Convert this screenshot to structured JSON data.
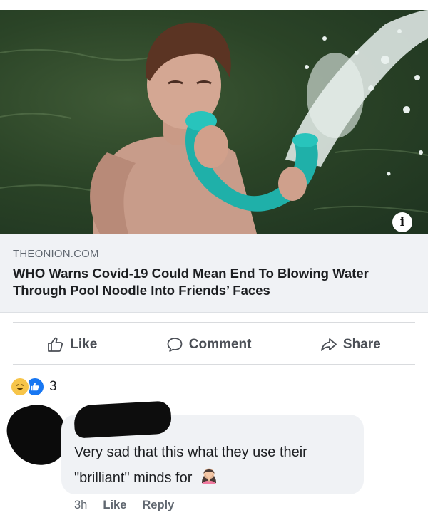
{
  "post": {
    "link_preview": {
      "domain": "THEONION.COM",
      "headline": "WHO Warns Covid-19 Could Mean End To Blowing Water Through Pool Noodle Into Friends’ Faces"
    },
    "actions": {
      "like_label": "Like",
      "comment_label": "Comment",
      "share_label": "Share"
    },
    "reactions": {
      "types": [
        "haha",
        "like"
      ],
      "count": "3"
    }
  },
  "comment": {
    "text": "Very sad that this what they use their \"brilliant\" minds for",
    "emoji": "woman-facepalming",
    "time": "3h",
    "like_label": "Like",
    "reply_label": "Reply"
  },
  "colors": {
    "link_box_bg": "#f0f2f5",
    "action_text": "#4b4f56",
    "like_blue": "#1877f2",
    "haha_yellow": "#f7c54a",
    "noodle_teal": "#1fb0a9"
  }
}
